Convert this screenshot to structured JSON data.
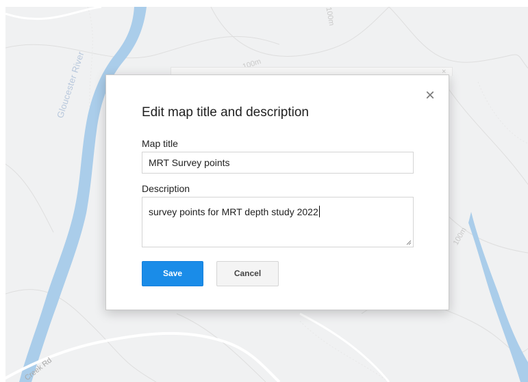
{
  "map": {
    "labels": {
      "river": "Gloucester River",
      "road": "Creek Rd",
      "contour_top": "100m",
      "contour_mid": "100m",
      "contour_right": "100m",
      "contour_far_top": "100m"
    },
    "colors": {
      "water": "#aacdea",
      "land": "#f0f1f2",
      "contour": "#dcdcdc",
      "road": "#ffffff"
    }
  },
  "dialog": {
    "title": "Edit map title and description",
    "close_icon": "×",
    "map_title": {
      "label": "Map title",
      "value": "MRT Survey points"
    },
    "description": {
      "label": "Description",
      "value": "survey points for MRT depth study 2022"
    },
    "buttons": {
      "save": "Save",
      "cancel": "Cancel"
    },
    "colors": {
      "save_button": "#1a8ce8",
      "cancel_button": "#f4f4f4"
    }
  },
  "background_dialog": {
    "close_icon": "×"
  }
}
